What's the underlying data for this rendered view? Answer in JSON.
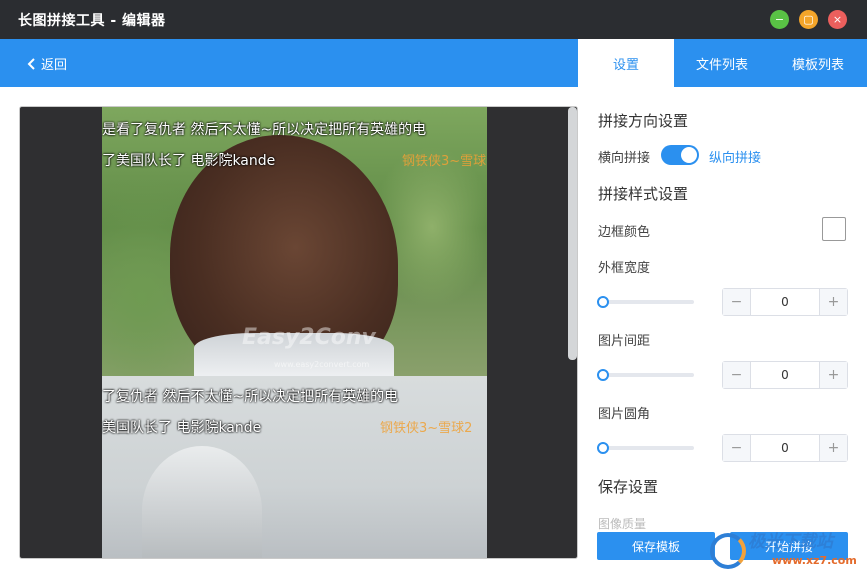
{
  "window": {
    "title": "长图拼接工具 - 编辑器",
    "controls": {
      "minimize": "−",
      "maximize": "▢",
      "close": "×"
    }
  },
  "toolbar": {
    "back_label": "返回",
    "tabs": [
      {
        "label": "设置",
        "active": true
      },
      {
        "label": "文件列表",
        "active": false
      },
      {
        "label": "模板列表",
        "active": false
      }
    ]
  },
  "preview": {
    "image1": {
      "subtitle_line1": "是看了复仇者 然后不太懂~所以决定把所有英雄的电",
      "subtitle_line2": "了美国队长了 电影院kande",
      "watermark": "钢铁侠3~雪球",
      "brand": "Easy2Conv",
      "brand_url": "www.easy2convert.com"
    },
    "image2": {
      "subtitle_line1": "了复仇者 然后不太懂~所以决定把所有英雄的电",
      "subtitle_line2": "美国队长了 电影院kande",
      "watermark": "钢铁侠3~雪球2"
    }
  },
  "settings": {
    "direction": {
      "title": "拼接方向设置",
      "left_label": "横向拼接",
      "right_label": "纵向拼接",
      "vertical_selected": true
    },
    "style": {
      "title": "拼接样式设置",
      "border_color_label": "边框颜色",
      "border_color": "#ffffff",
      "outer_width_label": "外框宽度",
      "outer_width_value": "0",
      "spacing_label": "图片间距",
      "spacing_value": "0",
      "radius_label": "图片圆角",
      "radius_value": "0"
    },
    "save": {
      "title": "保存设置",
      "partial_label": "图像质量"
    },
    "buttons": {
      "save_template": "保存模板",
      "start": "开始拼接"
    }
  },
  "site_watermark": {
    "text": "极光下载站",
    "url": "www.xz7.com"
  },
  "colors": {
    "accent": "#2b90ef",
    "titlebar": "#2b2d31",
    "min_button": "#59c245",
    "max_button": "#f4a52a",
    "close_button": "#ec5f5d"
  }
}
